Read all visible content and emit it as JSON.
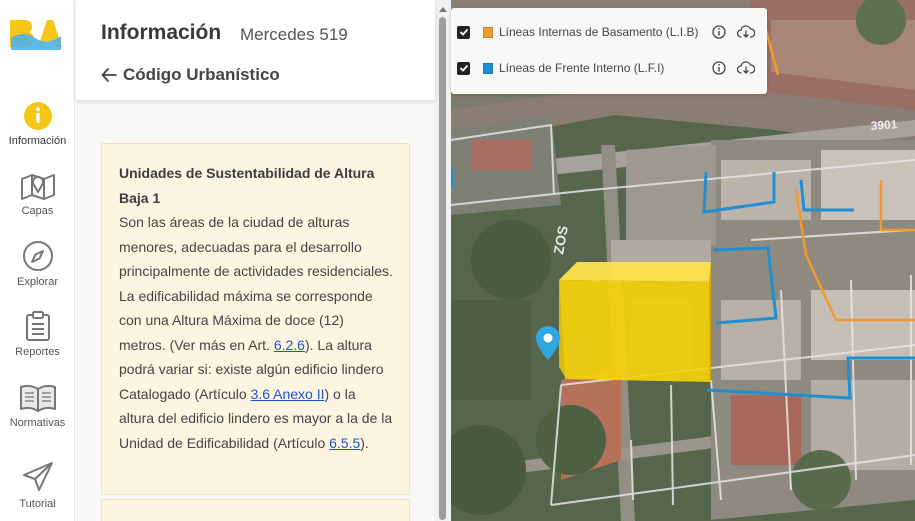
{
  "rail": {
    "logo_text": "BA",
    "items": [
      {
        "label": "Información",
        "icon": "info-icon"
      },
      {
        "label": "Capas",
        "icon": "map-layers-icon"
      },
      {
        "label": "Explorar",
        "icon": "compass-icon"
      },
      {
        "label": "Reportes",
        "icon": "clipboard-icon"
      },
      {
        "label": "Normativas",
        "icon": "book-icon"
      },
      {
        "label": "Tutorial",
        "icon": "paper-plane-icon"
      }
    ]
  },
  "panel": {
    "title": "Información",
    "address": "Mercedes 519",
    "back_label": "Código Urbanístico",
    "card": {
      "title_line1": "Unidades de Sustentabilidad de Altura",
      "title_line2": "Baja 1",
      "text_1": "Son las áreas de la ciudad de alturas menores, adecuadas para el desarrollo principalmente de actividades residenciales. La edificabilidad máxima se corresponde con una Altura Máxima de doce (12) metros. (Ver más en Art. ",
      "link_1": "6.2.6",
      "text_2": "). La altura podrá variar si: existe algún edificio lindero Catalogado (Artículo ",
      "link_2": "3.6 Anexo II",
      "text_3": ") o la altura del edificio lindero es mayor a la de la Unidad de Edificabilidad (Artículo ",
      "link_3": "6.5.5",
      "text_4": ")."
    }
  },
  "legend": {
    "layers": [
      {
        "label": "Líneas Internas de Basamento (L.I.B)",
        "color": "#f29a2e",
        "checked": true
      },
      {
        "label": "Líneas de Frente Interno (L.F.I)",
        "color": "#1f8fd1",
        "checked": true
      }
    ]
  },
  "map": {
    "street_label": "3901",
    "street_label_2": "ZOS"
  },
  "colors": {
    "accent_yellow": "#f5c518",
    "link": "#1f55c8",
    "card_bg": "#fdf5e2",
    "lib_line": "#f29a2e",
    "lfi_line": "#1f8fd1"
  }
}
